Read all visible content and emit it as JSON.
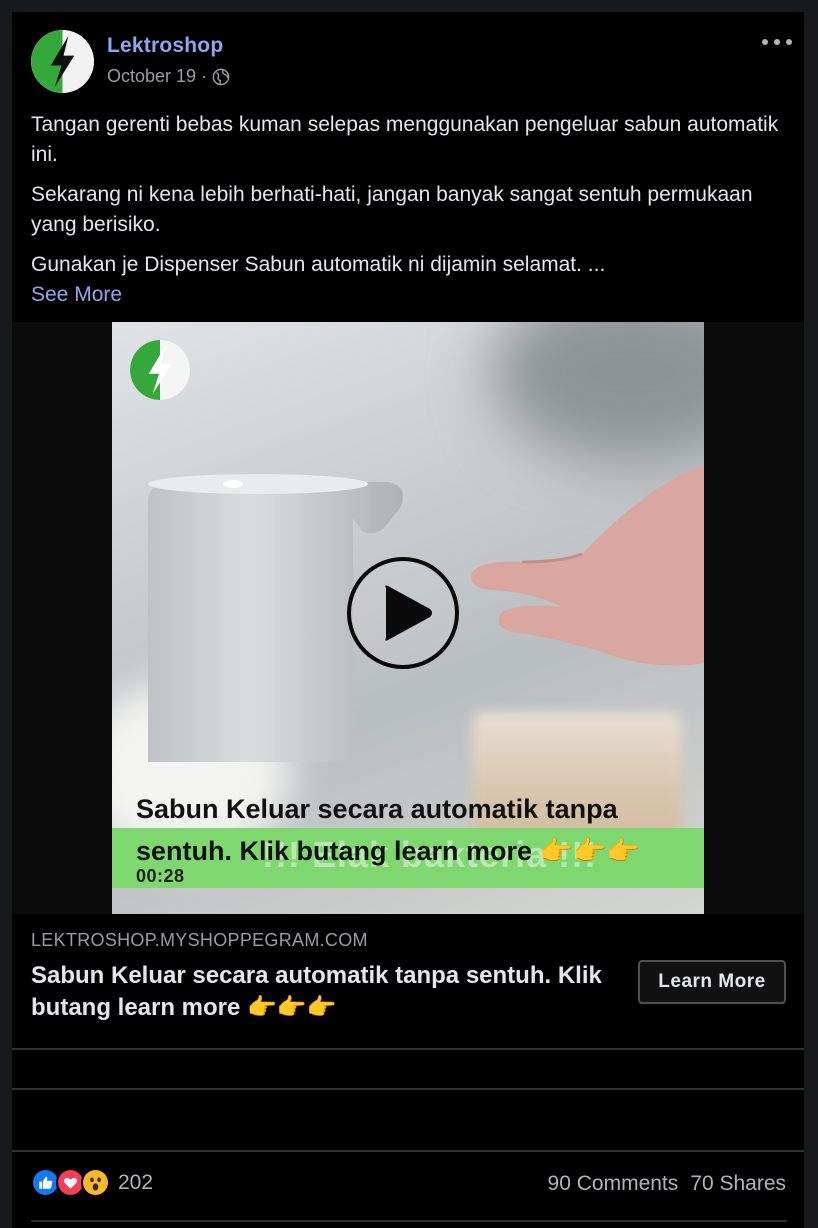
{
  "post": {
    "page_name": "Lektroshop",
    "date": "October 19",
    "meta_separator": "·",
    "privacy_icon": "globe-icon",
    "more_icon": "more-horizontal-icon",
    "paragraphs": [
      "Tangan gerenti bebas kuman selepas menggunakan pengeluar sabun automatik ini.",
      "Sekarang ni kena lebih berhati-hati, jangan banyak sangat sentuh permukaan yang berisiko.",
      "Gunakan je Dispenser Sabun automatik ni dijamin selamat. ..."
    ],
    "see_more": "See More"
  },
  "video": {
    "caption": "Sabun Keluar secara automatik tanpa sentuh. Klik butang learn more",
    "caption_emoji": "👉👉👉",
    "duration": "00:28",
    "overlay_text": "!!! Elak bakteria !!!",
    "play_icon": "play-icon"
  },
  "link_preview": {
    "domain": "LEKTROSHOP.MYSHOPPEGRAM.COM",
    "title": "Sabun Keluar secara automatik tanpa sentuh. Klik butang learn more",
    "title_emoji": "👉👉👉",
    "cta_label": "Learn More"
  },
  "engagement": {
    "reaction_icons": [
      "like-icon",
      "love-icon",
      "wow-icon"
    ],
    "reaction_count": "202",
    "comments": "90 Comments",
    "shares": "70 Shares"
  },
  "colors": {
    "background": "#18191c",
    "card": "#000000",
    "link_blue": "#8fa6ea",
    "muted_text": "#9a9ca1",
    "green_bar": "#7ed86f",
    "like_blue": "#1877f2",
    "love_red": "#f33e58",
    "wow_yellow": "#f7b928"
  }
}
